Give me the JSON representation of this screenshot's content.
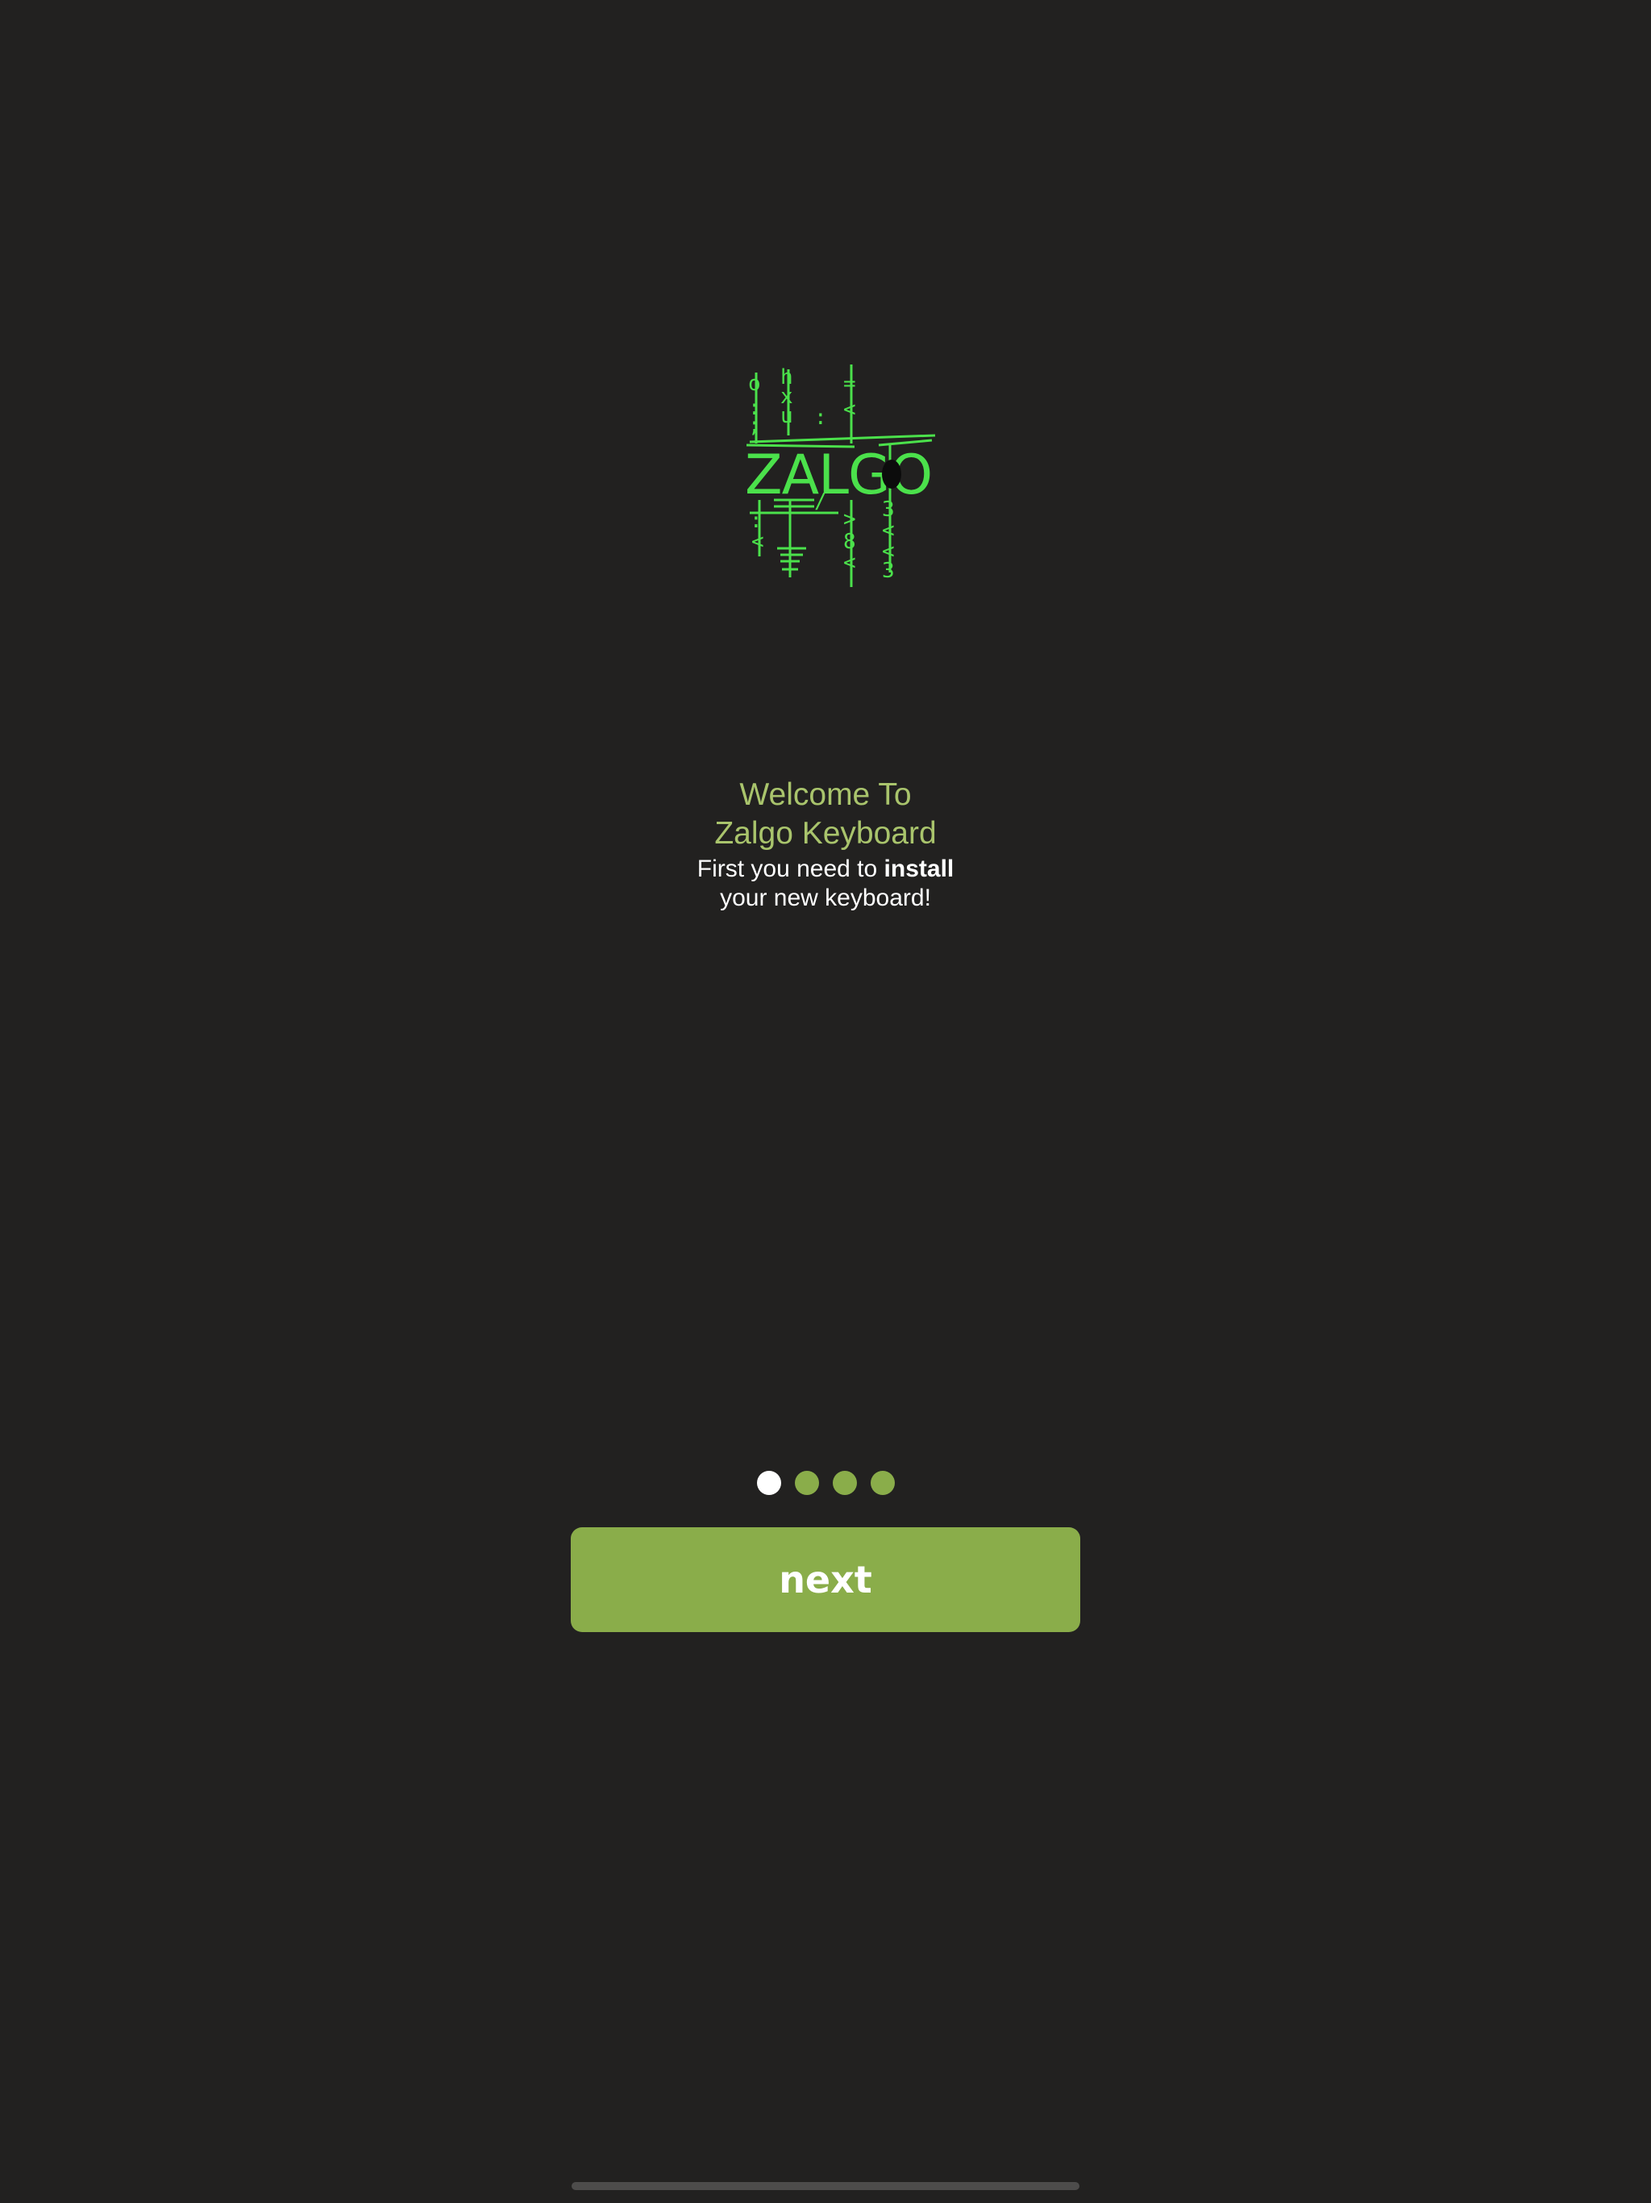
{
  "logo": {
    "icon": "zalgo-logo-icon",
    "word": "ZALGO",
    "color": "#4be14b"
  },
  "welcome": {
    "line1": "Welcome To",
    "line2": "Zalgo Keyboard",
    "color": "#a9c46c"
  },
  "instructions": {
    "prefix": "First you need to ",
    "emphasis": "install",
    "line2": "your new keyboard!"
  },
  "pager": {
    "total": 4,
    "current": 1,
    "active_color": "#ffffff",
    "inactive_color": "#8aad4a"
  },
  "next_button": {
    "label": "next",
    "color": "#8aad4a"
  },
  "background_color": "#222120"
}
